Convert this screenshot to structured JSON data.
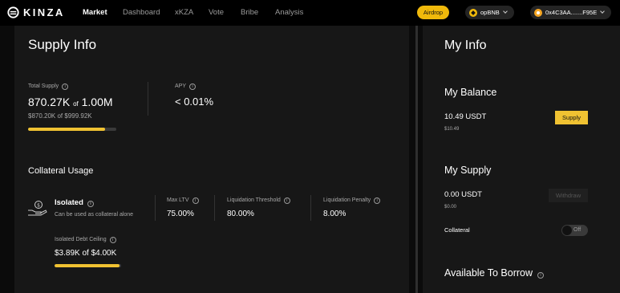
{
  "brand": {
    "name": "KINZA"
  },
  "nav": {
    "links": [
      "Market",
      "Dashboard",
      "xKZA",
      "Vote",
      "Bribe",
      "Analysis"
    ],
    "airdrop": "Airdrop",
    "network": "opBNB",
    "wallet": "0x4C3AA.......F95E"
  },
  "supply_info": {
    "title": "Supply Info",
    "total_supply": {
      "label": "Total Supply",
      "amount": "870.27K",
      "of": "of",
      "cap": "1.00M",
      "usd": "$870.20K of $999.92K",
      "progress": 0.87
    },
    "apy": {
      "label": "APY",
      "value": "< 0.01%"
    }
  },
  "collateral": {
    "title": "Collateral Usage",
    "isolated": {
      "label": "Isolated",
      "desc": "Can be used as collateral alone"
    },
    "max_ltv": {
      "label": "Max LTV",
      "value": "75.00%"
    },
    "liq_threshold": {
      "label": "Liquidation Threshold",
      "value": "80.00%"
    },
    "liq_penalty": {
      "label": "Liquidation Penalty",
      "value": "8.00%"
    },
    "debt_ceiling": {
      "label": "Isolated Debt Ceiling",
      "value": "$3.89K of $4.00K",
      "progress": 0.97
    }
  },
  "my_info": {
    "title": "My Info",
    "balance": {
      "title": "My Balance",
      "amount": "10.49 USDT",
      "usd": "$10.49",
      "button": "Supply"
    },
    "supply": {
      "title": "My Supply",
      "amount": "0.00 USDT",
      "usd": "$0.00",
      "button": "Withdraw"
    },
    "collateral": {
      "label": "Collateral",
      "toggle": "Off"
    },
    "borrow": {
      "title": "Available To Borrow"
    }
  },
  "colors": {
    "accent": "#f0c232",
    "panel": "#171717",
    "background": "#0b0b0b"
  }
}
